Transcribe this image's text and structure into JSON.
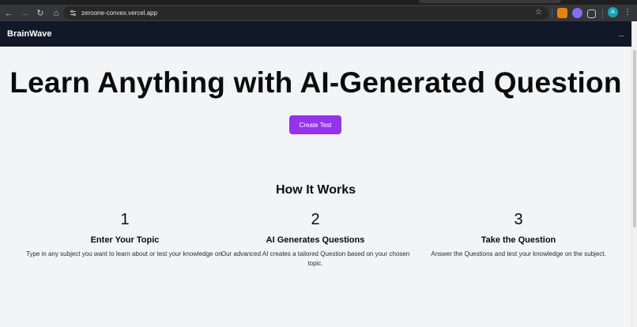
{
  "browser": {
    "url": "zeroone-convex.vercel.app",
    "profile_initial": "A"
  },
  "header": {
    "brand": "BrainWave",
    "menu": "..."
  },
  "hero": {
    "title": "Learn Anything with AI-Generated Question",
    "cta_label": "Create Test"
  },
  "how_it_works": {
    "title": "How It Works",
    "steps": [
      {
        "number": "1",
        "title": "Enter Your Topic",
        "description": "Type in any subject you want to learn about or test your knowledge on."
      },
      {
        "number": "2",
        "title": "AI Generates Questions",
        "description": "Our advanced AI creates a tailored Question based on your chosen topic."
      },
      {
        "number": "3",
        "title": "Take the Question",
        "description": "Answer the Questions and test your knowledge on the subject."
      }
    ]
  },
  "colors": {
    "header_bg": "#111827",
    "accent": "#9333ea",
    "page_bg": "#f3f4f6"
  }
}
